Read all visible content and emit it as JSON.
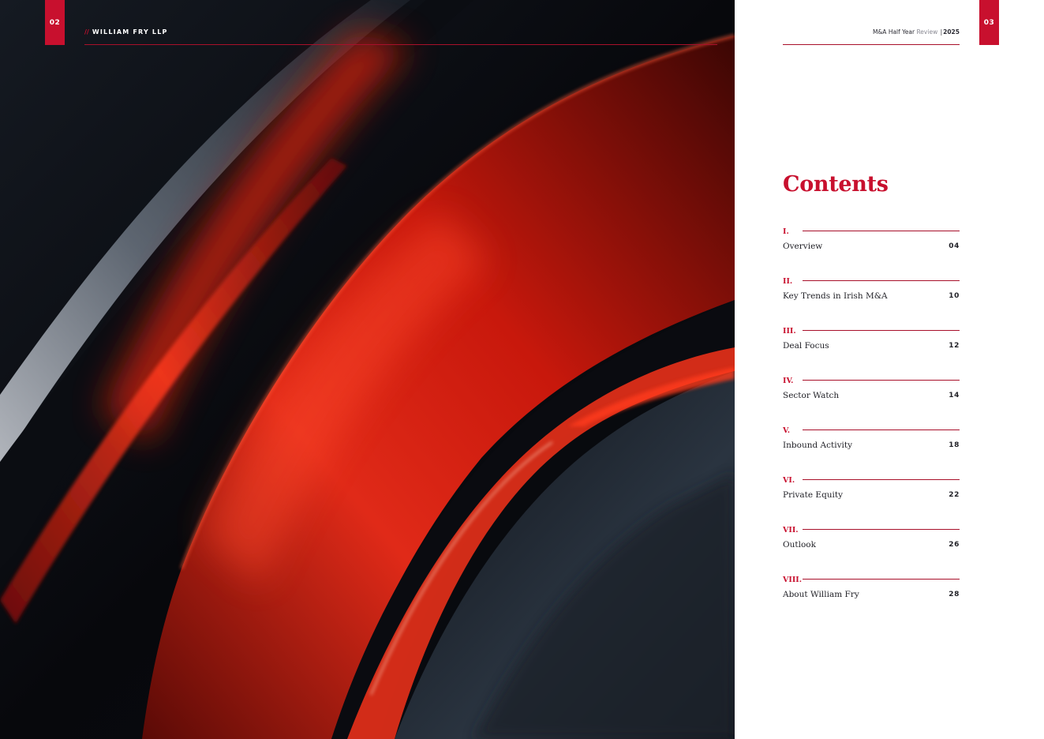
{
  "left_page": {
    "page_number": "02",
    "brand_prefix": "//",
    "brand_name": "WILLIAM FRY LLP"
  },
  "right_page": {
    "page_number": "03",
    "running_head": {
      "title_a": "M&A",
      "title_b": "Half Year",
      "title_c": "Review",
      "separator": "|",
      "year": "2025"
    },
    "contents_title": "Contents",
    "toc": [
      {
        "numeral": "I.",
        "label": "Overview",
        "page": "04"
      },
      {
        "numeral": "II.",
        "label": "Key Trends in Irish M&A",
        "page": "10"
      },
      {
        "numeral": "III.",
        "label": "Deal Focus",
        "page": "12"
      },
      {
        "numeral": "IV.",
        "label": "Sector Watch",
        "page": "14"
      },
      {
        "numeral": "V.",
        "label": "Inbound Activity",
        "page": "18"
      },
      {
        "numeral": "VI.",
        "label": "Private Equity",
        "page": "22"
      },
      {
        "numeral": "VII.",
        "label": "Outlook",
        "page": "26"
      },
      {
        "numeral": "VIII.",
        "label": "About William Fry",
        "page": "28"
      }
    ]
  },
  "colors": {
    "accent": "#c8102e",
    "rule": "#a8102a",
    "text": "#222228",
    "art_background": "#07080c"
  }
}
